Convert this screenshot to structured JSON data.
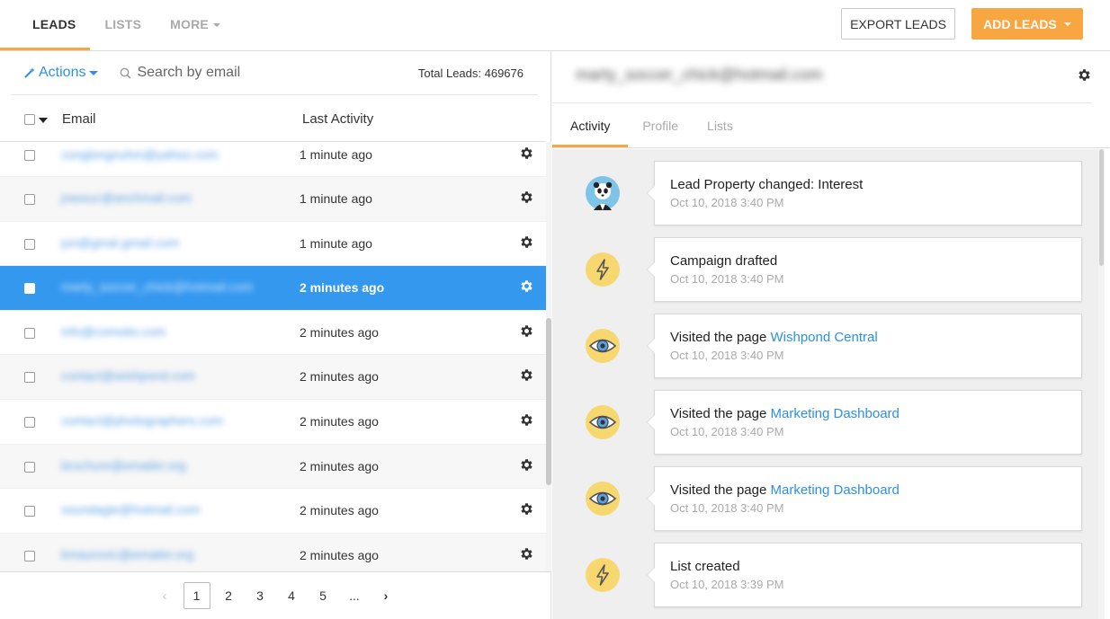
{
  "topnav": {
    "tabs": [
      "LEADS",
      "LISTS",
      "MORE"
    ],
    "export_label": "EXPORT LEADS",
    "add_label": "ADD LEADS"
  },
  "toolbar": {
    "actions_label": "Actions",
    "search_placeholder": "Search by email",
    "total_leads": "Total Leads: 469676"
  },
  "table": {
    "headers": {
      "email": "Email",
      "activity": "Last Activity"
    },
    "rows": [
      {
        "email": "conglongnuhm@yahoo.com",
        "time": "1 minute ago"
      },
      {
        "email": "jrassuc@anchmail.com",
        "time": "1 minute ago"
      },
      {
        "email": "jun@gmal.gmail.com",
        "time": "1 minute ago"
      },
      {
        "email": "marty_soccer_chick@hotmail.com",
        "time": "2 minutes ago",
        "selected": true
      },
      {
        "email": "info@comotio.com",
        "time": "2 minutes ago"
      },
      {
        "email": "contact@wishpond.com",
        "time": "2 minutes ago"
      },
      {
        "email": "contact@photographers.com",
        "time": "2 minutes ago"
      },
      {
        "email": "brochure@emailer.org",
        "time": "2 minutes ago"
      },
      {
        "email": "soundagie@hotmail.com",
        "time": "2 minutes ago"
      },
      {
        "email": "kmaurovic@emailer.org",
        "time": "2 minutes ago"
      }
    ]
  },
  "pager": {
    "prev": "‹",
    "pages": [
      "1",
      "2",
      "3",
      "4",
      "5",
      "..."
    ],
    "next": "›",
    "current": "1"
  },
  "detail": {
    "lead_email": "marty_soccer_chick@hotmail.com",
    "tabs": [
      "Activity",
      "Profile",
      "Lists"
    ],
    "activity": [
      {
        "icon": "panda-avatar-icon",
        "text": "Lead Property changed: Interest",
        "link": "",
        "date": "Oct 10, 2018 3:40 PM"
      },
      {
        "icon": "lightning-icon",
        "text": "Campaign drafted",
        "link": "",
        "date": "Oct 10, 2018 3:40 PM"
      },
      {
        "icon": "eye-icon",
        "text": "Visited the page ",
        "link": "Wishpond Central",
        "date": "Oct 10, 2018 3:40 PM"
      },
      {
        "icon": "eye-icon",
        "text": "Visited the page ",
        "link": "Marketing Dashboard",
        "date": "Oct 10, 2018 3:40 PM"
      },
      {
        "icon": "eye-icon",
        "text": "Visited the page ",
        "link": "Marketing Dashboard",
        "date": "Oct 10, 2018 3:40 PM"
      },
      {
        "icon": "lightning-icon",
        "text": "List created",
        "link": "",
        "date": "Oct 10, 2018 3:39 PM"
      }
    ]
  },
  "colors": {
    "accent": "#f7a642",
    "link": "#2d90e5",
    "selected_row": "#3498ef"
  }
}
